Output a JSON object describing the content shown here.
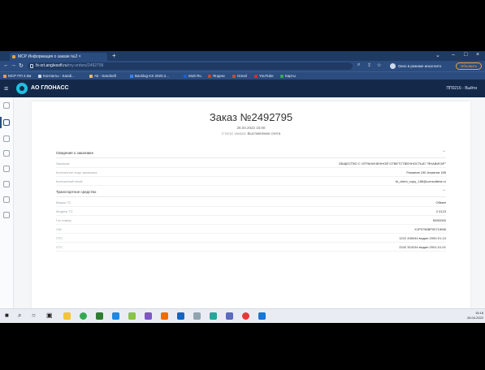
{
  "browser": {
    "tab_title": "МСР Информация о заказе №2 ×",
    "new_tab": "+",
    "url_host": "fs-srt.anglesoft.ru",
    "url_path": "/my-orders/2492795",
    "window_controls": [
      "⌄",
      "–",
      "□",
      "×"
    ],
    "profile_text": "Окно в режиме инкогнито",
    "update_button": "Обновить",
    "bookmarks": [
      {
        "label": "МСР ПП 2.0м",
        "color": "#f0a23a"
      },
      {
        "label": "Контакты - Sandi...",
        "color": "#cfd9ea"
      },
      {
        "label": "Ati - Sandsoft",
        "color": "#f0c040"
      },
      {
        "label": "Backlog KS 2020.2...",
        "color": "#3b82f6"
      },
      {
        "label": "Мой Ru",
        "color": "#1e5fd0"
      },
      {
        "label": "Яндекс",
        "color": "#e03a2a"
      },
      {
        "label": "Gmail",
        "color": "#d9433a"
      },
      {
        "label": "YouTube",
        "color": "#e02a2a"
      },
      {
        "label": "Карты",
        "color": "#34a853"
      }
    ]
  },
  "app": {
    "brand": "АО ГЛОНАСС",
    "user": "ПП0216 - Выйти"
  },
  "order": {
    "title": "Заказ №2492795",
    "date": "26.04.2022 15:00",
    "status_label": "Статус заказа:",
    "status_value": "Выставление счета"
  },
  "sections": [
    {
      "title": "Сведения о заказчике",
      "rows": [
        {
          "k": "Заказчик",
          "v": "ОБЩЕСТВО С ОГРАНИЧЕННОЙ ОТВЕТСТВЕННОСТЬЮ \"ЯНАВИГАР\""
        },
        {
          "k": "Контактное лицо заказчика",
          "v": "Романов 190 Ахматов 185"
        },
        {
          "k": "Контактный email",
          "v": "td_client_copy_185@consulttest.ru"
        }
      ]
    },
    {
      "title": "Транспортное средство",
      "rows": [
        {
          "k": "Марка ТС",
          "v": "Обмен"
        },
        {
          "k": "Модель ТС",
          "v": "2 0123"
        },
        {
          "k": "Гос номер",
          "v": "В000000"
        },
        {
          "k": "VIN",
          "v": "Х1Р0796ВР0071Ж66"
        },
        {
          "k": "ПТС",
          "v": "1222 438444 выдан 2000-01-10"
        },
        {
          "k": "СТС",
          "v": "2242 324234 выдан 2001-01-01"
        }
      ]
    }
  ],
  "taskbar": {
    "clock_time": "15:18",
    "clock_date": "26.04.2022"
  }
}
